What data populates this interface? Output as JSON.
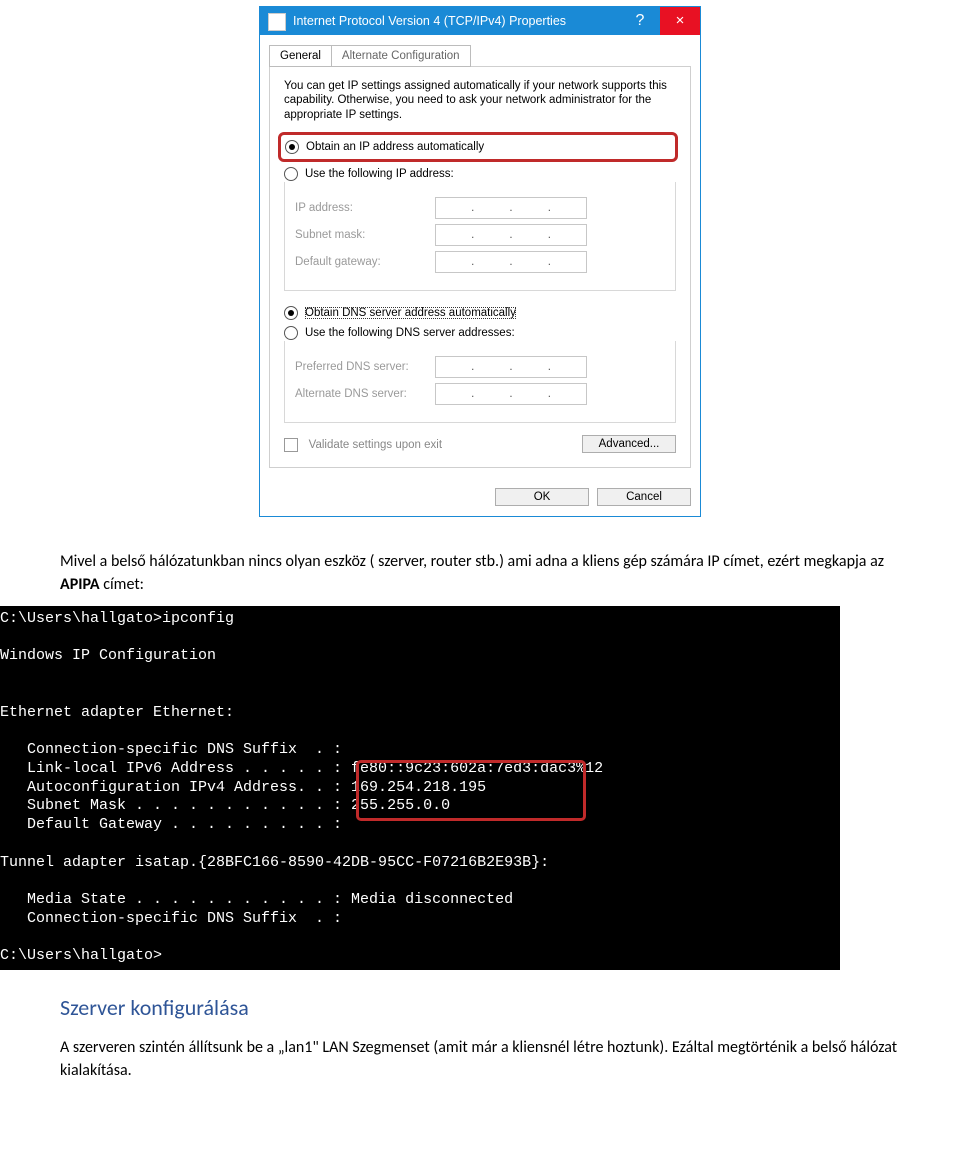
{
  "dialog": {
    "title": "Internet Protocol Version 4 (TCP/IPv4) Properties",
    "help_glyph": "?",
    "close_glyph": "×",
    "tabs": {
      "general": "General",
      "alt": "Alternate Configuration"
    },
    "intro": "You can get IP settings assigned automatically if your network supports this capability. Otherwise, you need to ask your network administrator for the appropriate IP settings.",
    "radio_ip_auto": "Obtain an IP address automatically",
    "radio_ip_static": "Use the following IP address:",
    "lbl_ip": "IP address:",
    "lbl_mask": "Subnet mask:",
    "lbl_gw": "Default gateway:",
    "radio_dns_auto": "Obtain DNS server address automatically",
    "radio_dns_static": "Use the following DNS server addresses:",
    "lbl_dns1": "Preferred DNS server:",
    "lbl_dns2": "Alternate DNS server:",
    "chk_validate": "Validate settings upon exit",
    "btn_advanced": "Advanced...",
    "btn_ok": "OK",
    "btn_cancel": "Cancel"
  },
  "doc": {
    "p1": "Mivel a belső hálózatunkban nincs olyan eszköz ( szerver, router stb.) ami adna a kliens gép számára IP címet, ezért megkapja az ",
    "p1_bold": "APIPA",
    "p1_after": " címet:",
    "heading": "Szerver konfigurálása",
    "p2": "A szerveren szintén állítsunk be a „lan1\" LAN Szegmenset (amit már a kliensnél létre hoztunk). Ezáltal megtörténik a belső hálózat kialakítása."
  },
  "terminal": {
    "l1": "C:\\Users\\hallgato>ipconfig",
    "l2": "",
    "l3": "Windows IP Configuration",
    "l4": "",
    "l5": "",
    "l6": "Ethernet adapter Ethernet:",
    "l7": "",
    "l8": "   Connection-specific DNS Suffix  . :",
    "l9": "   Link-local IPv6 Address . . . . . : fe80::9c23:602a:7ed3:dac3%12",
    "l10": "   Autoconfiguration IPv4 Address. . : 169.254.218.195",
    "l11": "   Subnet Mask . . . . . . . . . . . : 255.255.0.0",
    "l12": "   Default Gateway . . . . . . . . . :",
    "l13": "",
    "l14": "Tunnel adapter isatap.{28BFC166-8590-42DB-95CC-F07216B2E93B}:",
    "l15": "",
    "l16": "   Media State . . . . . . . . . . . : Media disconnected",
    "l17": "   Connection-specific DNS Suffix  . :",
    "l18": "",
    "l19": "C:\\Users\\hallgato>"
  }
}
